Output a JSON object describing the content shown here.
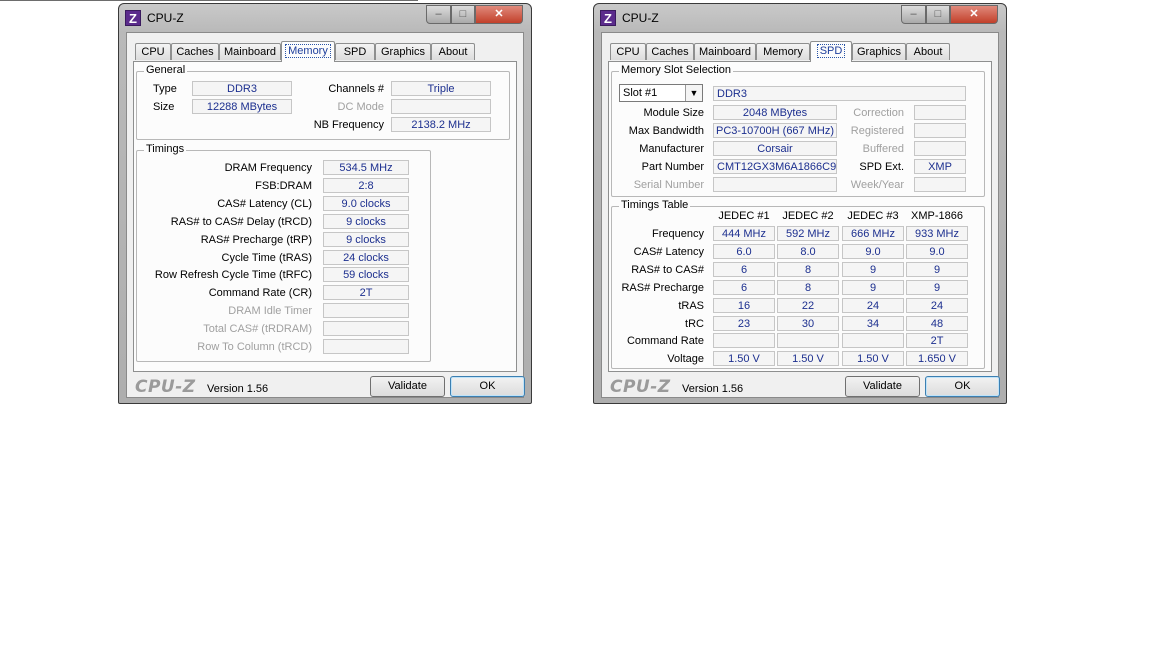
{
  "app_title": "CPU-Z",
  "icon_letter": "Z",
  "logo_text": "CPU-Z",
  "version_text": "Version 1.56",
  "buttons": {
    "validate": "Validate",
    "ok": "OK"
  },
  "tabs": [
    "CPU",
    "Caches",
    "Mainboard",
    "Memory",
    "SPD",
    "Graphics",
    "About"
  ],
  "memory": {
    "general_title": "General",
    "type_label": "Type",
    "type_value": "DDR3",
    "size_label": "Size",
    "size_value": "12288 MBytes",
    "channels_label": "Channels #",
    "channels_value": "Triple",
    "dcmode_label": "DC Mode",
    "dcmode_value": "",
    "nbfreq_label": "NB Frequency",
    "nbfreq_value": "2138.2 MHz",
    "timings_title": "Timings",
    "timings": [
      {
        "label": "DRAM Frequency",
        "value": "534.5 MHz"
      },
      {
        "label": "FSB:DRAM",
        "value": "2:8"
      },
      {
        "label": "CAS# Latency (CL)",
        "value": "9.0 clocks"
      },
      {
        "label": "RAS# to CAS# Delay (tRCD)",
        "value": "9 clocks"
      },
      {
        "label": "RAS# Precharge (tRP)",
        "value": "9 clocks"
      },
      {
        "label": "Cycle Time (tRAS)",
        "value": "24 clocks"
      },
      {
        "label": "Row Refresh Cycle Time (tRFC)",
        "value": "59 clocks"
      },
      {
        "label": "Command Rate (CR)",
        "value": "2T"
      },
      {
        "label": "DRAM Idle Timer",
        "value": ""
      },
      {
        "label": "Total CAS# (tRDRAM)",
        "value": ""
      },
      {
        "label": "Row To Column (tRCD)",
        "value": ""
      }
    ]
  },
  "spd": {
    "slot_section_title": "Memory Slot Selection",
    "slot_selected": "Slot #1",
    "slot_type": "DDR3",
    "module_size_label": "Module Size",
    "module_size_value": "2048 MBytes",
    "max_bw_label": "Max Bandwidth",
    "max_bw_value": "PC3-10700H (667 MHz)",
    "manufacturer_label": "Manufacturer",
    "manufacturer_value": "Corsair",
    "part_label": "Part Number",
    "part_value": "CMT12GX3M6A1866C9",
    "serial_label": "Serial Number",
    "serial_value": "",
    "correction_label": "Correction",
    "correction_value": "",
    "registered_label": "Registered",
    "registered_value": "",
    "buffered_label": "Buffered",
    "buffered_value": "",
    "spdext_label": "SPD Ext.",
    "spdext_value": "XMP",
    "weekyear_label": "Week/Year",
    "weekyear_value": "",
    "timings_table_title": "Timings Table",
    "columns": [
      "JEDEC #1",
      "JEDEC #2",
      "JEDEC #3",
      "XMP-1866"
    ],
    "rows": [
      {
        "label": "Frequency",
        "values": [
          "444 MHz",
          "592 MHz",
          "666 MHz",
          "933 MHz"
        ]
      },
      {
        "label": "CAS# Latency",
        "values": [
          "6.0",
          "8.0",
          "9.0",
          "9.0"
        ]
      },
      {
        "label": "RAS# to CAS#",
        "values": [
          "6",
          "8",
          "9",
          "9"
        ]
      },
      {
        "label": "RAS# Precharge",
        "values": [
          "6",
          "8",
          "9",
          "9"
        ]
      },
      {
        "label": "tRAS",
        "values": [
          "16",
          "22",
          "24",
          "24"
        ]
      },
      {
        "label": "tRC",
        "values": [
          "23",
          "30",
          "34",
          "48"
        ]
      },
      {
        "label": "Command Rate",
        "values": [
          "",
          "",
          "",
          "2T"
        ]
      },
      {
        "label": "Voltage",
        "values": [
          "1.50 V",
          "1.50 V",
          "1.50 V",
          "1.650 V"
        ]
      }
    ]
  }
}
